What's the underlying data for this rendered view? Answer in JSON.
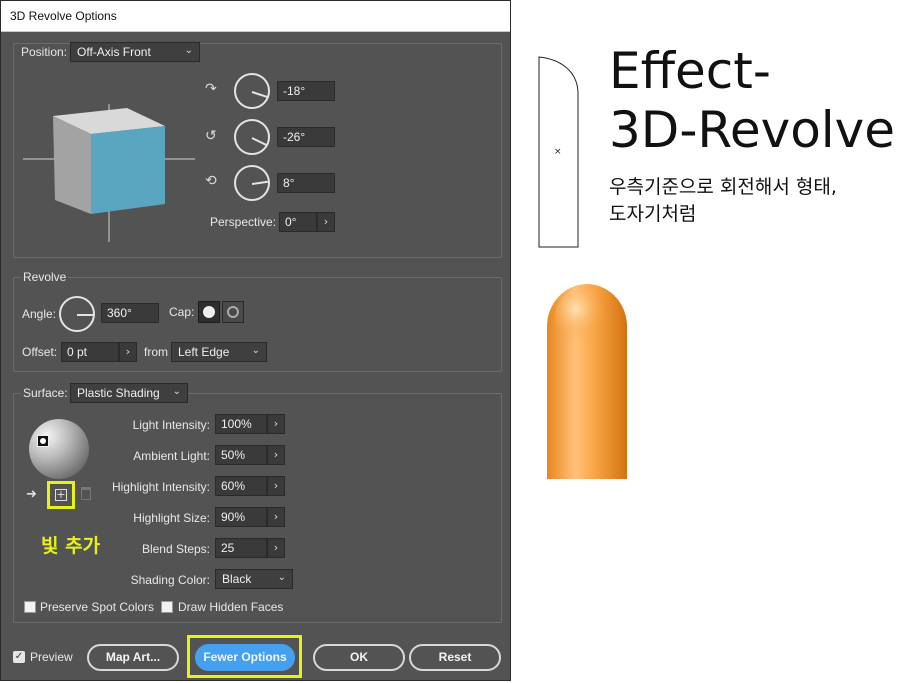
{
  "dialog": {
    "title": "3D Revolve Options",
    "position": {
      "label": "Position:",
      "value": "Off-Axis Front",
      "rot_x": "-18°",
      "rot_y": "-26°",
      "rot_z": "8°",
      "perspective_label": "Perspective:",
      "perspective_value": "0°"
    },
    "revolve": {
      "group_label": "Revolve",
      "angle_label": "Angle:",
      "angle_value": "360°",
      "cap_label": "Cap:",
      "offset_label": "Offset:",
      "offset_value": "0 pt",
      "from_label": "from",
      "from_value": "Left Edge"
    },
    "surface": {
      "label": "Surface:",
      "value": "Plastic Shading",
      "light_intensity_label": "Light Intensity:",
      "light_intensity": "100%",
      "ambient_light_label": "Ambient Light:",
      "ambient_light": "50%",
      "highlight_intensity_label": "Highlight Intensity:",
      "highlight_intensity": "60%",
      "highlight_size_label": "Highlight Size:",
      "highlight_size": "90%",
      "blend_steps_label": "Blend Steps:",
      "blend_steps": "25",
      "shading_color_label": "Shading Color:",
      "shading_color": "Black",
      "annotation": "빛 추가"
    },
    "preserve_spot_colors": "Preserve Spot Colors",
    "draw_hidden_faces": "Draw Hidden Faces",
    "preview_label": "Preview",
    "buttons": {
      "map_art": "Map Art...",
      "fewer_options": "Fewer Options",
      "ok": "OK",
      "reset": "Reset"
    }
  },
  "slide": {
    "title_line1": "Effect-",
    "title_line2": "3D-Revolve",
    "desc_line1": "우측기준으로 회전해서 형태,",
    "desc_line2": "도자기처럼"
  },
  "colors": {
    "dialog_bg": "#535353",
    "highlight_box": "#e7f316",
    "primary_button": "#46a0f0",
    "cube_front": "#5aa6c0",
    "revolved_shape": "#f59a2c"
  }
}
